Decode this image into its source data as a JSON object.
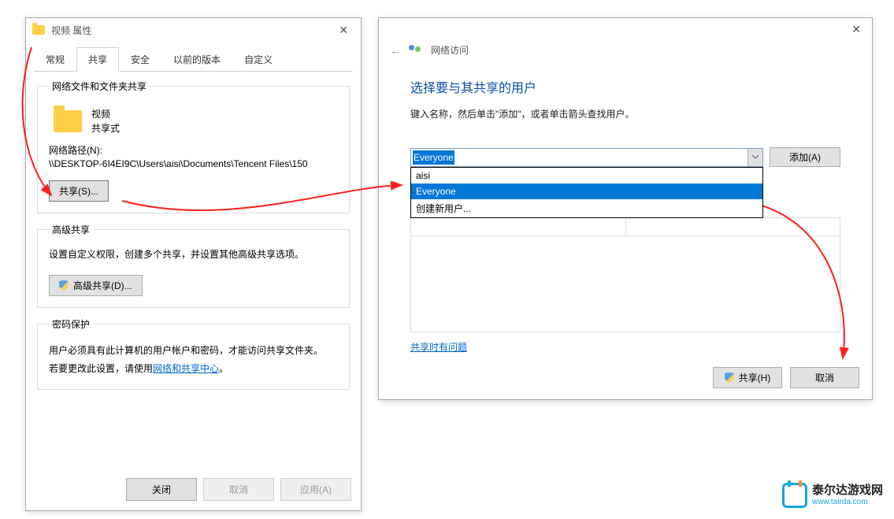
{
  "props": {
    "title": "视频 属性",
    "tabs": {
      "general": "常规",
      "share": "共享",
      "security": "安全",
      "prev": "以前的版本",
      "custom": "自定义"
    },
    "group_share_legend": "网络文件和文件夹共享",
    "item_name": "视频",
    "item_status": "共享式",
    "netpath_label": "网络路径(N):",
    "netpath_value": "\\\\DESKTOP-6I4EI9C\\Users\\aisi\\Documents\\Tencent Files\\150",
    "share_btn": "共享(S)...",
    "group_adv_legend": "高级共享",
    "adv_text": "设置自定义权限，创建多个共享，并设置其他高级共享选项。",
    "adv_btn": "高级共享(D)...",
    "group_pwd_legend": "密码保护",
    "pwd_line1": "用户必须具有此计算机的用户帐户和密码，才能访问共享文件夹。",
    "pwd_line2_pre": "若要更改此设置，请使用",
    "pwd_link": "网络和共享中心",
    "pwd_line2_post": "。",
    "close_btn": "关闭",
    "cancel_btn": "取消",
    "apply_btn": "应用(A)"
  },
  "dlg": {
    "title": "网络访问",
    "heading": "选择要与其共享的用户",
    "sub": "键入名称，然后单击\"添加\"，或者单击箭头查找用户。",
    "input_value": "Everyone",
    "add_btn": "添加(A)",
    "options": {
      "o1": "aisi",
      "o2": "Everyone",
      "o3": "创建新用户..."
    },
    "help_link": "共享时有问题",
    "share_btn": "共享(H)",
    "cancel_btn": "取消"
  },
  "watermark": {
    "cn": "泰尔达游戏网",
    "en": "www.tairda.com"
  }
}
